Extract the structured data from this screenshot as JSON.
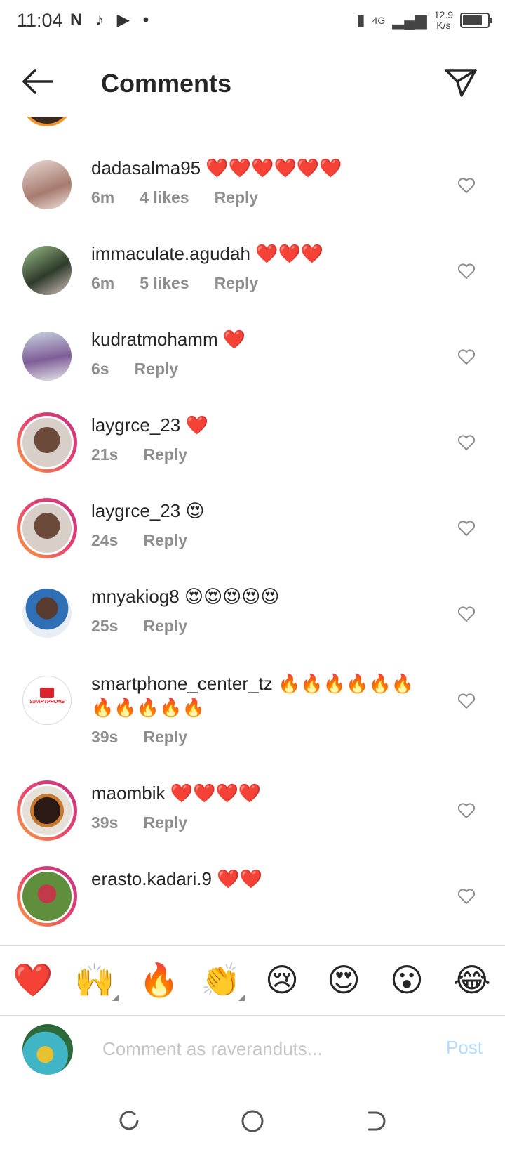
{
  "status": {
    "time": "11:04",
    "network": "4G",
    "speed_value": "12.9",
    "speed_unit": "K/s"
  },
  "header": {
    "title": "Comments"
  },
  "comments": [
    {
      "username": "dadasalma95",
      "emoji": "❤️❤️❤️❤️❤️❤️",
      "time": "6m",
      "likes": "4 likes",
      "reply": "Reply"
    },
    {
      "username": "immaculate.agudah",
      "emoji": "❤️❤️❤️",
      "time": "6m",
      "likes": "5 likes",
      "reply": "Reply"
    },
    {
      "username": "kudratmohamm",
      "emoji": "❤️",
      "time": "6s",
      "likes": "",
      "reply": "Reply"
    },
    {
      "username": "laygrce_23",
      "emoji": "❤️",
      "time": "21s",
      "likes": "",
      "reply": "Reply"
    },
    {
      "username": "laygrce_23",
      "emoji": "😍",
      "time": "24s",
      "likes": "",
      "reply": "Reply"
    },
    {
      "username": "mnyakiog8",
      "emoji": "😍😍😍😍😍",
      "time": "25s",
      "likes": "",
      "reply": "Reply"
    },
    {
      "username": "smartphone_center_tz",
      "emoji": "🔥🔥🔥🔥🔥🔥🔥🔥🔥🔥🔥",
      "time": "39s",
      "likes": "",
      "reply": "Reply"
    },
    {
      "username": "maombik",
      "emoji": "❤️❤️❤️❤️",
      "time": "39s",
      "likes": "",
      "reply": "Reply"
    },
    {
      "username": "erasto.kadari.9",
      "emoji": "❤️❤️",
      "time": "",
      "likes": "",
      "reply": ""
    }
  ],
  "emoji_bar": [
    "❤️",
    "🙌",
    "🔥",
    "👏",
    "😢",
    "😍",
    "😮",
    "😂"
  ],
  "input": {
    "placeholder": "Comment as raveranduts...",
    "post_label": "Post"
  },
  "colors": {
    "text": "#262626",
    "meta": "#8e8e8e",
    "post": "#b3dbff",
    "heart_outline": "#8e8e8e"
  }
}
